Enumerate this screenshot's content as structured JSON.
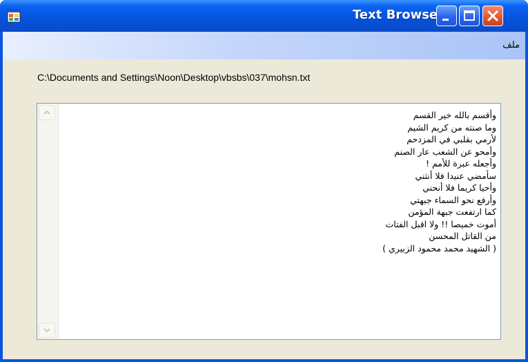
{
  "window": {
    "title": "Text Browser",
    "accent": "#0a55de",
    "close_color": "#e15a37"
  },
  "menu": {
    "items": [
      {
        "label": "ملف"
      }
    ]
  },
  "file_path": "C:\\Documents and Settings\\Noon\\Desktop\\vbsbs\\037\\mohsn.txt",
  "text": {
    "lines": [
      "وأقسم بالله خير القسم",
      "وما صنته من كريم الشيم",
      "لأرمي بقلبي في المزدحم",
      "وأمحو عن الشعب عار الصنم",
      "وأجعله عبرة للأمم !",
      "سأمضي عنيدا فلا أنثني",
      "وأحيا كريما فلا أنحني",
      "وأرفع نحو السماء جبهتي",
      "كما ارتفعت جبهة المؤمن",
      "أموت خميصا !! ولا اقبل الفتات",
      "من القاتل المحسن",
      "( الشهيد محمد محمود الزبيري )"
    ]
  },
  "icons": {
    "app": "form-icon",
    "minimize": "minimize-icon",
    "maximize": "maximize-icon",
    "close": "close-icon",
    "scroll_up": "chevron-up-icon",
    "scroll_down": "chevron-down-icon"
  }
}
